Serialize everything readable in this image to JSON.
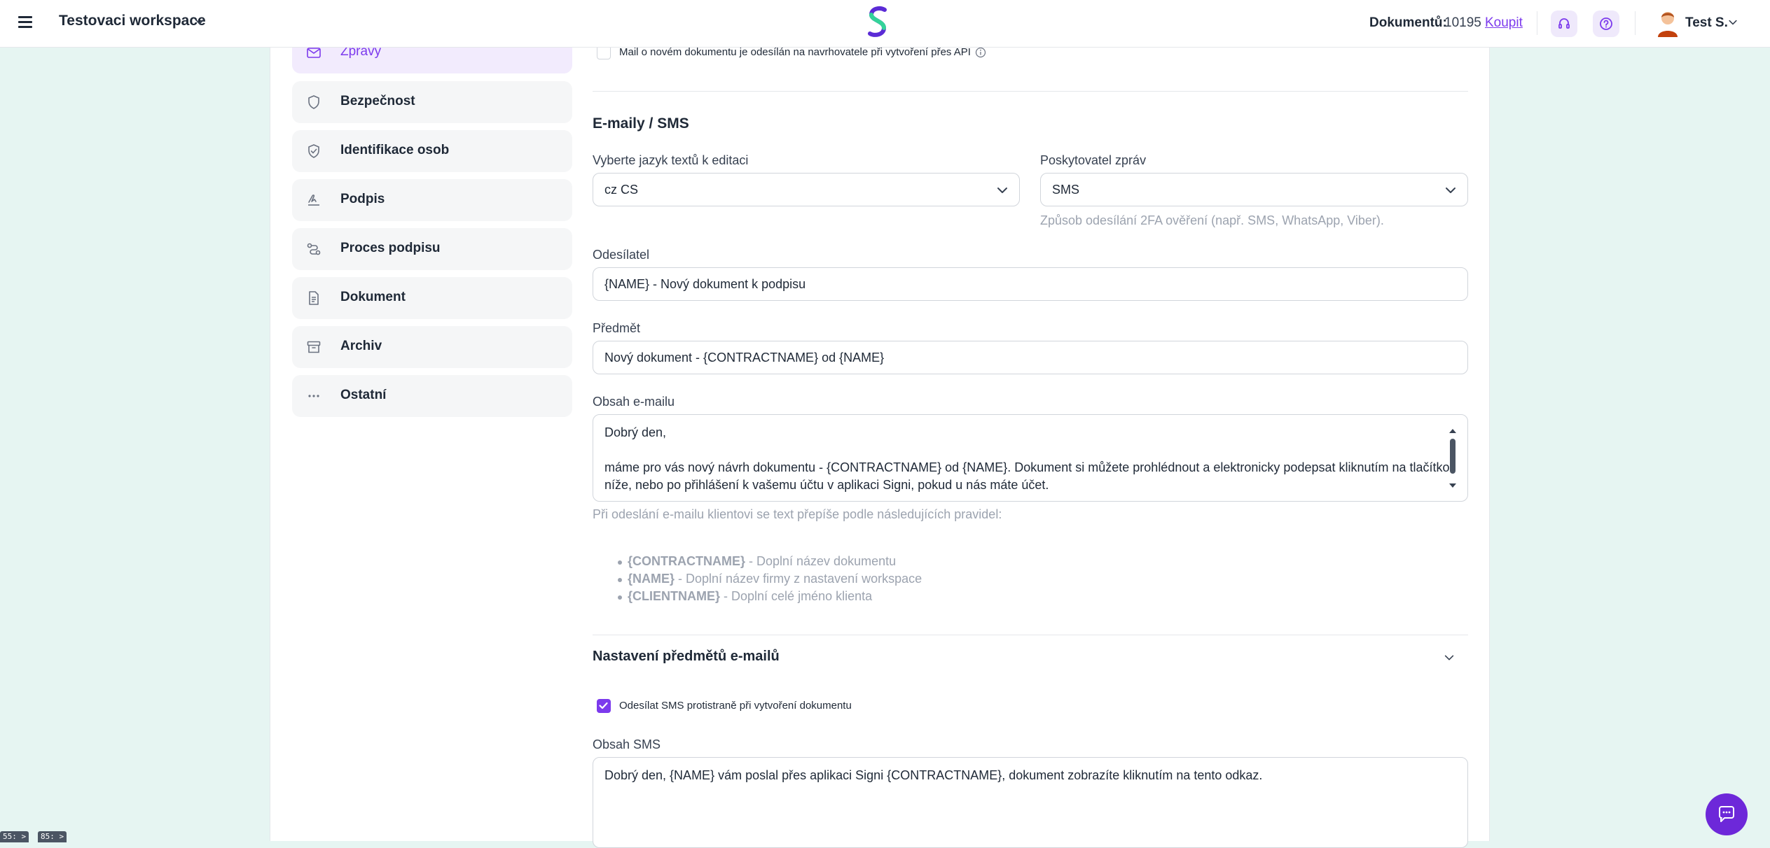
{
  "header": {
    "workspace_name": "Testovaci workspace",
    "documents_label": "Dokumentů:",
    "documents_count": "10195",
    "buy_link": "Koupit",
    "user_name": "Test S."
  },
  "sidebar": {
    "items": [
      {
        "label": "Zprávy",
        "icon": "mail-icon",
        "active": true
      },
      {
        "label": "Bezpečnost",
        "icon": "shield-icon"
      },
      {
        "label": "Identifikace osob",
        "icon": "shield-check-icon"
      },
      {
        "label": "Podpis",
        "icon": "signature-icon"
      },
      {
        "label": "Proces podpisu",
        "icon": "workflow-icon"
      },
      {
        "label": "Dokument",
        "icon": "document-icon"
      },
      {
        "label": "Archiv",
        "icon": "archive-icon"
      },
      {
        "label": "Ostatní",
        "icon": "more-icon"
      }
    ]
  },
  "form": {
    "api_mail_checkbox": {
      "label": "Mail o novém dokumentu je odesílán na navrhovatele při vytvoření přes API",
      "checked": false
    },
    "section_title": "E-maily / SMS",
    "language": {
      "label": "Vyberte jazyk textů k editaci",
      "value": "cz  CS"
    },
    "provider": {
      "label": "Poskytovatel zpráv",
      "value": "SMS",
      "hint": "Způsob odesílání 2FA ověření (např. SMS, WhatsApp, Viber)."
    },
    "sender": {
      "label": "Odesílatel",
      "value": "{NAME} - Nový dokument k podpisu"
    },
    "subject": {
      "label": "Předmět",
      "value": "Nový dokument - {CONTRACTNAME} od {NAME}"
    },
    "email_body": {
      "label": "Obsah e-mailu",
      "lines": [
        "Dobrý den,",
        "",
        "máme pro vás nový návrh dokumentu - {CONTRACTNAME} od {NAME}. Dokument si můžete prohlédnout a elektronicky podepsat kliknutím na tlačítko",
        "níže, nebo po přihlášení k vašemu účtu v aplikaci Signi, pokud u nás máte účet."
      ]
    },
    "rules_intro": "Při odeslání e-mailu klientovi se text přepíše podle následujících pravidel:",
    "rules": [
      {
        "token": "{CONTRACTNAME}",
        "desc": " - Doplní název dokumentu"
      },
      {
        "token": "{NAME}",
        "desc": " - Doplní název firmy z nastavení workspace"
      },
      {
        "token": "{CLIENTNAME}",
        "desc": " - Doplní celé jméno klienta"
      }
    ],
    "subjects_section": "Nastavení předmětů e-mailů",
    "sms_checkbox": {
      "label": "Odesílat SMS protistraně při vytvoření dokumentu",
      "checked": true
    },
    "sms_body": {
      "label": "Obsah SMS",
      "value": "Dobrý den, {NAME} vám poslal přes aplikaci Signi {CONTRACTNAME}, dokument zobrazíte kliknutím na tento odkaz."
    }
  },
  "corner_badges": [
    "55: >",
    "85: >"
  ],
  "colors": {
    "accent": "#7c3aed",
    "page_background": "#e6f5f2",
    "chat_button": "#6d28d9"
  }
}
